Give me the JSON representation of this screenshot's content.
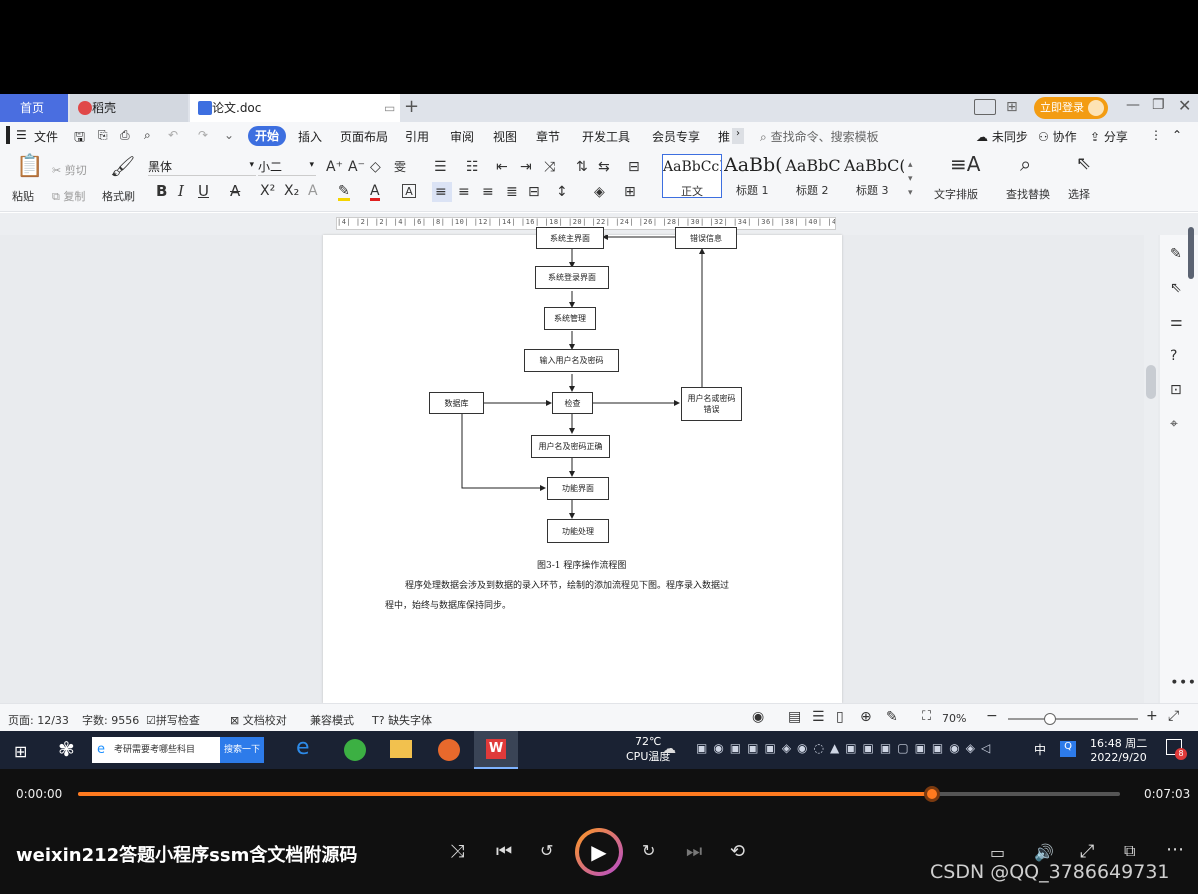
{
  "tabs": {
    "home": "首页",
    "daoke": "稻壳",
    "doc": "论文.doc",
    "plus": "+"
  },
  "login": "立即登录",
  "menu": {
    "file": "文件",
    "start": "开始",
    "items": [
      "插入",
      "页面布局",
      "引用",
      "审阅",
      "视图",
      "章节",
      "开发工具",
      "会员专享",
      "推"
    ],
    "search": "查找命令、搜索模板",
    "unsync": "未同步",
    "collab": "协作",
    "share": "分享"
  },
  "ribbon": {
    "paste": "粘贴",
    "cut": "剪切",
    "copy": "复制",
    "format_painter": "格式刷",
    "font": "黑体",
    "size": "小二",
    "styles": [
      {
        "preview": "AaBbCcI",
        "name": "正文"
      },
      {
        "preview": "AaBb(",
        "name": "标题 1"
      },
      {
        "preview": "AaBbC",
        "name": "标题 2"
      },
      {
        "preview": "AaBbC(",
        "name": "标题 3"
      }
    ],
    "text_layout": "文字排版",
    "find_replace": "查找替换",
    "select": "选择"
  },
  "ruler": "|4| |2| |2| |4| |6| |8| |10| |12| |14| |16| |18| |20| |22| |24| |26| |28| |30| |32| |34| |36| |38| |40| |42|",
  "flowchart": {
    "n_main": "系统主界面",
    "n_err_info": "错误信息",
    "n_login": "系统登录界面",
    "n_mgmt": "系统管理",
    "n_input": "输入用户名及密码",
    "n_db": "数据库",
    "n_check": "检查",
    "n_err": "用户名或密码错误",
    "n_ok": "用户名及密码正确",
    "n_func": "功能界面",
    "n_proc": "功能处理"
  },
  "caption": "图3-1 程序操作流程图",
  "para1": "程序处理数据会涉及到数据的录入环节，绘制的添加流程见下图。程序录入数据过",
  "para2": "程中，始终与数据库保持同步。",
  "status": {
    "page": "页面: 12/33",
    "words": "字数: 9556",
    "spell": "拼写检查",
    "proof": "文档校对",
    "compat": "兼容模式",
    "missing_font": "缺失字体",
    "zoom": "70%"
  },
  "taskbar": {
    "search_text": "考研需要考哪些科目",
    "search_btn": "搜索一下",
    "temp": "72℃",
    "cpu": "CPU温度",
    "time": "16:48 周二",
    "date": "2022/9/20",
    "ime": "中",
    "notif": "8"
  },
  "player": {
    "elapsed": "0:00:00",
    "total": "0:07:03",
    "title": "weixin212答题小程序ssm含文档附源码",
    "progress": 0.82,
    "watermark": "CSDN @QQ_3786649731"
  }
}
